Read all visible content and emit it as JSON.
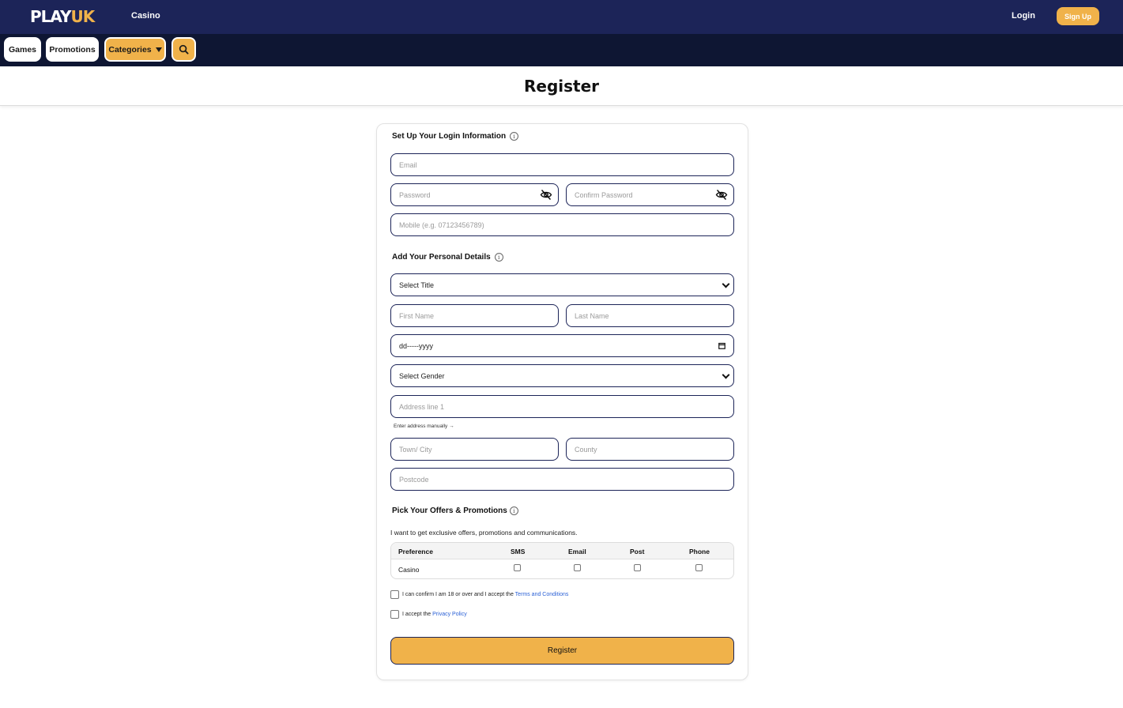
{
  "topbar": {
    "logo_part1": "PLAY",
    "logo_part2": "UK",
    "nav_casino": "Casino",
    "login": "Login",
    "signup": "Sign Up"
  },
  "subnav": {
    "games": "Games",
    "promotions": "Promotions",
    "categories": "Categories",
    "search_icon": "search-icon"
  },
  "page": {
    "title": "Register"
  },
  "login_section": {
    "title": "Set Up Your Login Information",
    "email_placeholder": "Email",
    "password_placeholder": "Password",
    "confirm_password_placeholder": "Confirm Password",
    "mobile_placeholder": "Mobile (e.g. 07123456789)",
    "password_toggle_icon": "eye-off-icon"
  },
  "personal_section": {
    "title": "Add Your Personal Details",
    "title_select": "Select Title",
    "first_name_placeholder": "First Name",
    "last_name_placeholder": "Last Name",
    "dob_placeholder": "dd-----yyyy",
    "gender_select": "Select Gender",
    "address_placeholder": "Address line 1",
    "manual_address_link": "Enter address manually →",
    "town_placeholder": "Town/ City",
    "county_placeholder": "County",
    "postcode_placeholder": "Postcode"
  },
  "offers_section": {
    "title": "Pick Your Offers & Promotions",
    "description": "I want to get exclusive offers, promotions and communications.",
    "table_headers": [
      "Preference",
      "SMS",
      "Email",
      "Post",
      "Phone"
    ],
    "rows": [
      {
        "label": "Casino",
        "sms": false,
        "email": false,
        "post": false,
        "phone": false
      }
    ]
  },
  "agreements": {
    "age_text": "I can confirm I am 18 or over and I accept the ",
    "terms_link": "Terms and Conditions",
    "age_checked": false,
    "privacy_text": "I accept the ",
    "privacy_link": "Privacy Policy",
    "privacy_checked": false
  },
  "register_button": "Register",
  "colors": {
    "navy": "#1c2458",
    "navy_dark": "#0e1633",
    "accent": "#f0b24a",
    "link": "#2b61d6"
  }
}
